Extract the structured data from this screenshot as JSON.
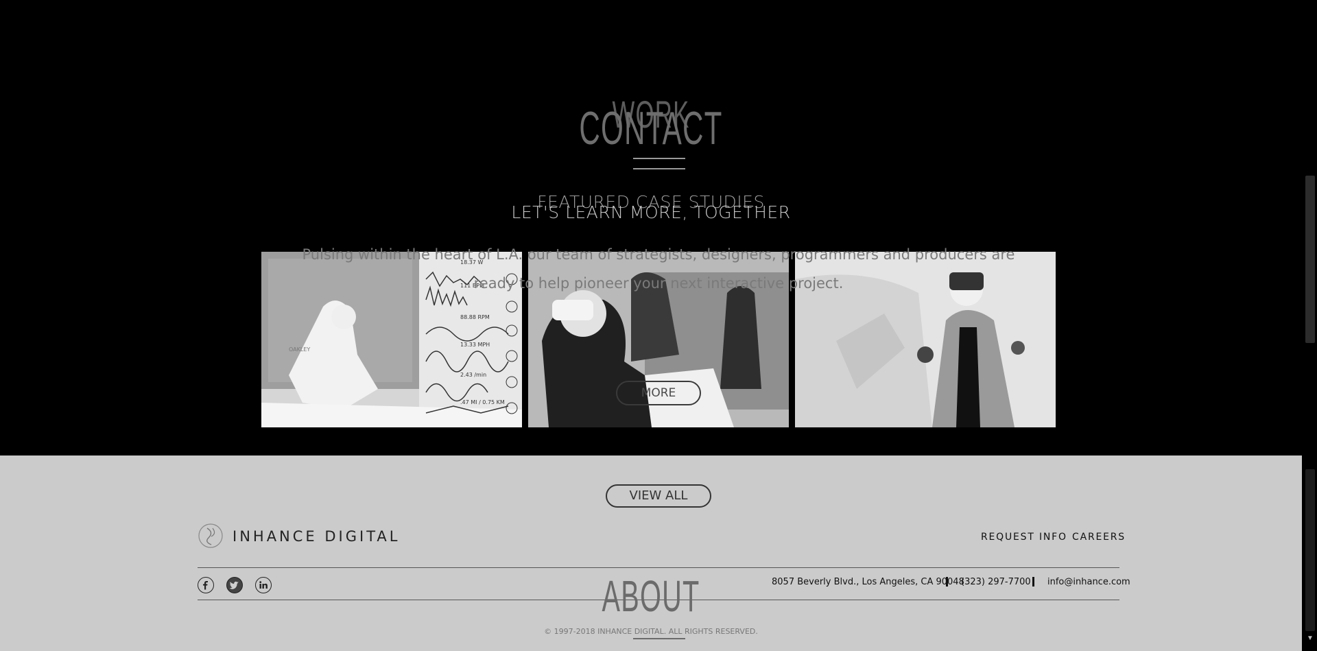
{
  "sections": {
    "work_title": "WORK",
    "contact_title": "CONTACT",
    "featured_heading": "FEATURED CASE STUDIES",
    "learn_heading": "LET'S LEARN MORE, TOGETHER",
    "paragraph_line1": "Pulsing within the heart of L.A. our team of strategists, designers, programmers and producers are",
    "paragraph_line2": "ready to help pioneer your next interactive project.",
    "more_label": "MORE",
    "view_all_label": "VIEW ALL",
    "about_title": "ABOUT"
  },
  "gallery": {
    "tile1_stats": [
      "18.37 W",
      "111 BPM",
      "88.88 RPM",
      "13.33 MPH",
      "2.43 /min",
      ".47 MI / 0.75 KM"
    ],
    "tile1_brand": "OAKLEY"
  },
  "footer": {
    "brand": "INHANCE DIGITAL",
    "links": {
      "request_info": "REQUEST INFO",
      "careers": "CAREERS"
    },
    "address": "8057 Beverly Blvd., Los Angeles, CA 90048",
    "phone": "(323) 297-7700",
    "email": "info@inhance.com",
    "copyright": "© 1997-2018 INHANCE DIGITAL. ALL RIGHTS RESERVED.",
    "social": [
      "facebook-icon",
      "twitter-icon",
      "linkedin-icon"
    ]
  },
  "colors": {
    "dark_bg": "#000000",
    "footer_bg": "#cbcbcb",
    "text_dark": "#111111"
  }
}
